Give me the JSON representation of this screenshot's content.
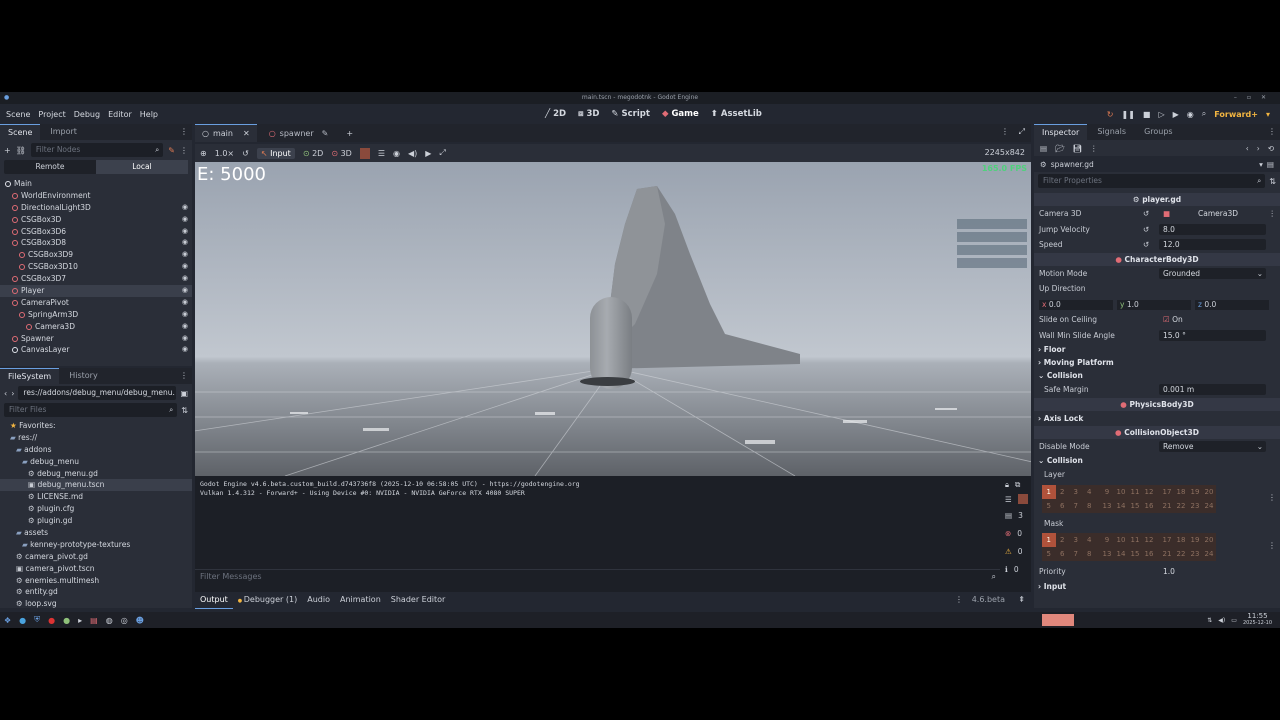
{
  "window": {
    "title": "main.tscn - megodotnk - Godot Engine"
  },
  "menu": [
    "Scene",
    "Project",
    "Debug",
    "Editor",
    "Help"
  ],
  "main_screens": [
    {
      "label": "2D"
    },
    {
      "label": "3D"
    },
    {
      "label": "Script"
    },
    {
      "label": "Game",
      "active": true
    },
    {
      "label": "AssetLib"
    }
  ],
  "renderer": "Forward+",
  "scene_dock": {
    "tabs": [
      "Scene",
      "Import"
    ],
    "filter_placeholder": "Filter Nodes",
    "remote": "Remote",
    "local": "Local",
    "nodes": [
      {
        "name": "Main",
        "depth": 0,
        "color": "#e0e3ea"
      },
      {
        "name": "WorldEnvironment",
        "depth": 1,
        "color": "#e06c75"
      },
      {
        "name": "DirectionalLight3D",
        "depth": 1,
        "color": "#e06c75",
        "vis": true
      },
      {
        "name": "CSGBox3D",
        "depth": 1,
        "color": "#e06c75",
        "vis": true
      },
      {
        "name": "CSGBox3D6",
        "depth": 1,
        "color": "#e06c75",
        "vis": true
      },
      {
        "name": "CSGBox3D8",
        "depth": 1,
        "color": "#e06c75",
        "vis": true
      },
      {
        "name": "CSGBox3D9",
        "depth": 2,
        "color": "#e06c75",
        "vis": true
      },
      {
        "name": "CSGBox3D10",
        "depth": 2,
        "color": "#e06c75",
        "vis": true
      },
      {
        "name": "CSGBox3D7",
        "depth": 1,
        "color": "#e06c75",
        "vis": true
      },
      {
        "name": "Player",
        "depth": 1,
        "color": "#e06c75",
        "vis": true,
        "selected": true
      },
      {
        "name": "CameraPivot",
        "depth": 1,
        "color": "#e06c75",
        "vis": true
      },
      {
        "name": "SpringArm3D",
        "depth": 2,
        "color": "#e06c75",
        "vis": true
      },
      {
        "name": "Camera3D",
        "depth": 3,
        "color": "#e06c75",
        "vis": true
      },
      {
        "name": "Spawner",
        "depth": 1,
        "color": "#e06c75",
        "vis": true
      },
      {
        "name": "CanvasLayer",
        "depth": 1,
        "color": "#e0e3ea",
        "vis": true
      }
    ]
  },
  "filesystem": {
    "tabs": [
      "FileSystem",
      "History"
    ],
    "path": "res://addons/debug_menu/debug_menu.",
    "filter_placeholder": "Filter Files",
    "items": [
      {
        "name": "Favorites:",
        "depth": 0,
        "kind": "fav"
      },
      {
        "name": "res://",
        "depth": 0,
        "kind": "folder"
      },
      {
        "name": "addons",
        "depth": 1,
        "kind": "folder"
      },
      {
        "name": "debug_menu",
        "depth": 2,
        "kind": "folder"
      },
      {
        "name": "debug_menu.gd",
        "depth": 3,
        "kind": "file"
      },
      {
        "name": "debug_menu.tscn",
        "depth": 3,
        "kind": "scene",
        "selected": true
      },
      {
        "name": "LICENSE.md",
        "depth": 3,
        "kind": "file"
      },
      {
        "name": "plugin.cfg",
        "depth": 3,
        "kind": "file"
      },
      {
        "name": "plugin.gd",
        "depth": 3,
        "kind": "file"
      },
      {
        "name": "assets",
        "depth": 1,
        "kind": "folder"
      },
      {
        "name": "kenney-prototype-textures",
        "depth": 2,
        "kind": "folder"
      },
      {
        "name": "camera_pivot.gd",
        "depth": 1,
        "kind": "file"
      },
      {
        "name": "camera_pivot.tscn",
        "depth": 1,
        "kind": "scene"
      },
      {
        "name": "enemies.multimesh",
        "depth": 1,
        "kind": "file"
      },
      {
        "name": "entity.gd",
        "depth": 1,
        "kind": "file"
      },
      {
        "name": "loop.svg",
        "depth": 1,
        "kind": "file"
      }
    ]
  },
  "editor_tabs": [
    {
      "label": "main",
      "active": true
    },
    {
      "label": "spawner"
    }
  ],
  "game_toolbar": {
    "zoom": "1.0×",
    "input": "Input",
    "mode_2d": "2D",
    "mode_3d": "3D",
    "resolution": "2245x842"
  },
  "game": {
    "counter": "E: 5000",
    "fps": "165.0 FPS"
  },
  "output": {
    "lines": [
      "Godot Engine v4.6.beta.custom_build.d743736f8 (2025-12-10 06:58:05 UTC) - https://godotengine.org",
      "Vulkan 1.4.312 - Forward+ - Using Device #0: NVIDIA - NVIDIA GeForce RTX 4080 SUPER"
    ],
    "filter_placeholder": "Filter Messages",
    "counts": [
      "3",
      "0",
      "0",
      "0"
    ]
  },
  "bottom_tabs": [
    {
      "label": "Output",
      "active": true
    },
    {
      "label": "Debugger (1)"
    },
    {
      "label": "Audio"
    },
    {
      "label": "Animation"
    },
    {
      "label": "Shader Editor"
    }
  ],
  "version": "4.6.beta",
  "inspector": {
    "tabs": [
      "Inspector",
      "Signals",
      "Groups"
    ],
    "resource": "spawner.gd",
    "filter_placeholder": "Filter Properties",
    "script_section": "player.gd",
    "camera_label": "Camera 3D",
    "camera_value": "Camera3D",
    "jump_label": "Jump Velocity",
    "jump_value": "8.0",
    "speed_label": "Speed",
    "speed_value": "12.0",
    "cb_section": "CharacterBody3D",
    "motion_label": "Motion Mode",
    "motion_value": "Grounded",
    "up_label": "Up Direction",
    "up": {
      "x": "0.0",
      "y": "1.0",
      "z": "0.0"
    },
    "slide_label": "Slide on Ceiling",
    "slide_value": "On",
    "wall_label": "Wall Min Slide Angle",
    "wall_value": "15.0 °",
    "floor": "Floor",
    "moving_platform": "Moving Platform",
    "collision": "Collision",
    "safe_label": "Safe Margin",
    "safe_value": "0.001 m",
    "pb_section": "PhysicsBody3D",
    "axis_lock": "Axis Lock",
    "co_section": "CollisionObject3D",
    "disable_label": "Disable Mode",
    "disable_value": "Remove",
    "collision2": "Collision",
    "layer_label": "Layer",
    "mask_label": "Mask",
    "bits_row1": [
      "1",
      "2",
      "3",
      "4",
      "9",
      "10",
      "11",
      "12",
      "17",
      "18",
      "19",
      "20"
    ],
    "bits_row2": [
      "5",
      "6",
      "7",
      "8",
      "13",
      "14",
      "15",
      "16",
      "21",
      "22",
      "23",
      "24"
    ],
    "priority_label": "Priority",
    "priority_value": "1.0",
    "input": "Input"
  },
  "taskbar": {
    "time": "11:55",
    "date": "2025-12-10"
  },
  "colors": {
    "accent": "#6a9fe0",
    "node_red": "#e06c75",
    "bit_on": "#b0523b",
    "renderer": "#f2b541"
  }
}
